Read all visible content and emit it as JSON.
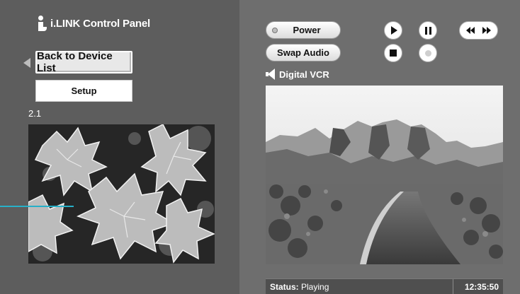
{
  "app": {
    "title": "i.LINK Control Panel"
  },
  "left": {
    "back_label": "Back to Device List",
    "setup_label": "Setup",
    "channel": "2.1"
  },
  "controls": {
    "power_label": "Power",
    "swap_label": "Swap Audio"
  },
  "device": {
    "name": "Digital VCR"
  },
  "status": {
    "prefix": "Status:",
    "value": "Playing",
    "time": "12:35:50"
  },
  "colors": {
    "pointer_line": "#27b0c8",
    "left_panel": "#5d5d5d",
    "right_panel": "#6e6e6e"
  },
  "icons": {
    "logo": "ilink-logo",
    "back": "back-arrow-icon",
    "play": "play-icon",
    "pause": "pause-icon",
    "stop": "stop-icon",
    "record": "record-icon",
    "rewind": "rewind-icon",
    "fast_forward": "fast-forward-icon",
    "audio": "speaker-icon"
  }
}
